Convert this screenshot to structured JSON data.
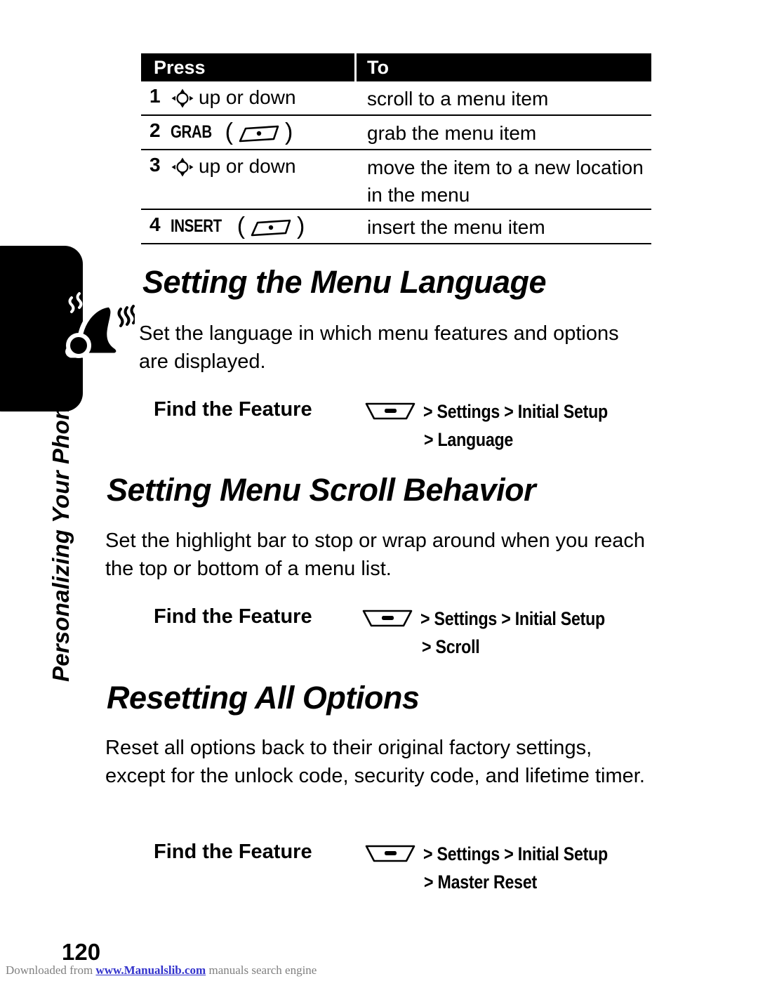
{
  "chapter": {
    "label": "Personalizing Your Phone",
    "icon": "ringing-bell-icon"
  },
  "steps_table": {
    "headers": [
      "Press",
      "To"
    ],
    "rows": [
      {
        "num": "1",
        "action_icon": "nav-key-icon",
        "action_text": "up or down",
        "key_label": "",
        "to": "scroll to a menu item"
      },
      {
        "num": "2",
        "action_icon": "soft-key-icon",
        "action_text": "",
        "key_label": "GRAB",
        "to": "grab the menu item"
      },
      {
        "num": "3",
        "action_icon": "nav-key-icon",
        "action_text": "up or down",
        "key_label": "",
        "to": "move the item to a new location in the menu"
      },
      {
        "num": "4",
        "action_icon": "soft-key-icon",
        "action_text": "",
        "key_label": "INSERT",
        "to": "insert the menu item"
      }
    ]
  },
  "sections": [
    {
      "heading": "Setting the Menu Language",
      "body": "Set the language in which menu features and options are displayed.",
      "find_label": "Find the Feature",
      "path_icon": "menu-key-icon",
      "path_line1": "> Settings > Initial Setup",
      "path_line2": "> Language"
    },
    {
      "heading": "Setting Menu Scroll Behavior",
      "body": "Set the highlight bar to stop or wrap around when you reach the top or bottom of a menu list.",
      "find_label": "Find the Feature",
      "path_icon": "menu-key-icon",
      "path_line1": "> Settings > Initial Setup",
      "path_line2": "> Scroll"
    },
    {
      "heading": "Resetting All Options",
      "body": "Reset all options back to their original factory settings, except for the unlock code, security code, and lifetime timer.",
      "find_label": "Find the Feature",
      "path_icon": "menu-key-icon",
      "path_line1": "> Settings > Initial Setup",
      "path_line2": "> Master Reset"
    }
  ],
  "page_number": "120",
  "footer": {
    "prefix": "Downloaded from ",
    "link": "www.Manualslib.com",
    "suffix": " manuals search engine"
  },
  "colors": {
    "ink": "#000000",
    "paper": "#ffffff",
    "link": "#3333cc",
    "footer_text": "#808080"
  }
}
